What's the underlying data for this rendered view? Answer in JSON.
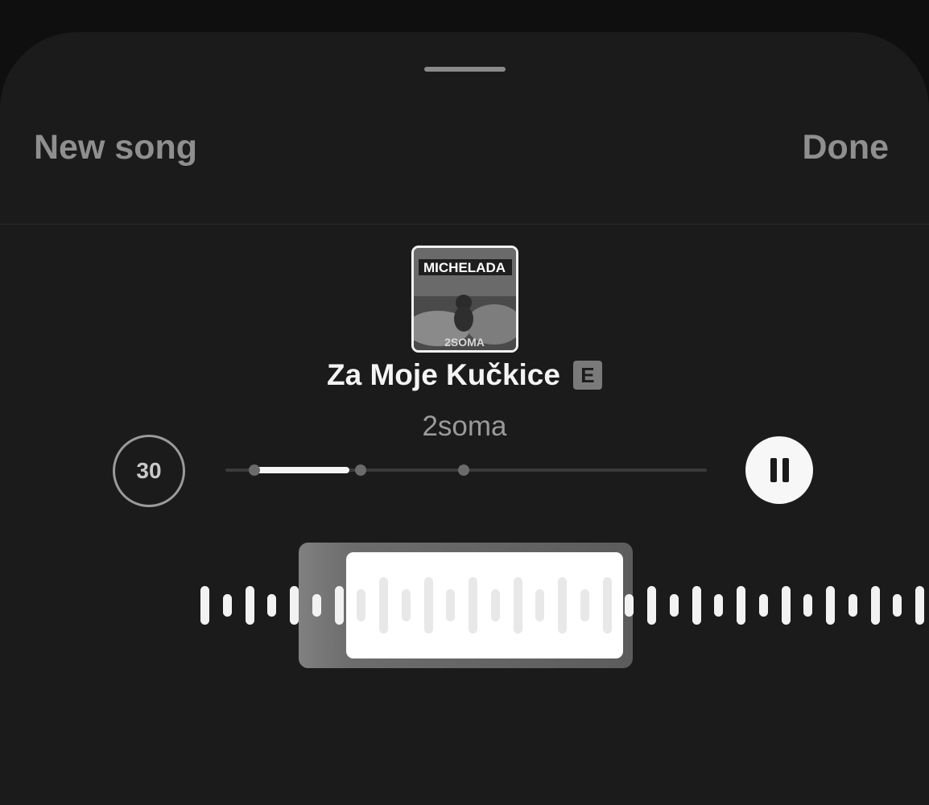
{
  "header": {
    "new_song_label": "New song",
    "done_label": "Done"
  },
  "track": {
    "title": "Za Moje Kučkice",
    "explicit_badge": "E",
    "artist": "2soma",
    "cover_text_top": "MICHELADA",
    "cover_text_bottom": "2SOMA"
  },
  "player": {
    "clip_duration": "30",
    "progress_fraction": 0.21,
    "pause_icon": "pause-icon"
  },
  "colors": {
    "background": "#1b1b1b",
    "accent": "#f5f5f5",
    "muted": "#8f8f8f"
  }
}
